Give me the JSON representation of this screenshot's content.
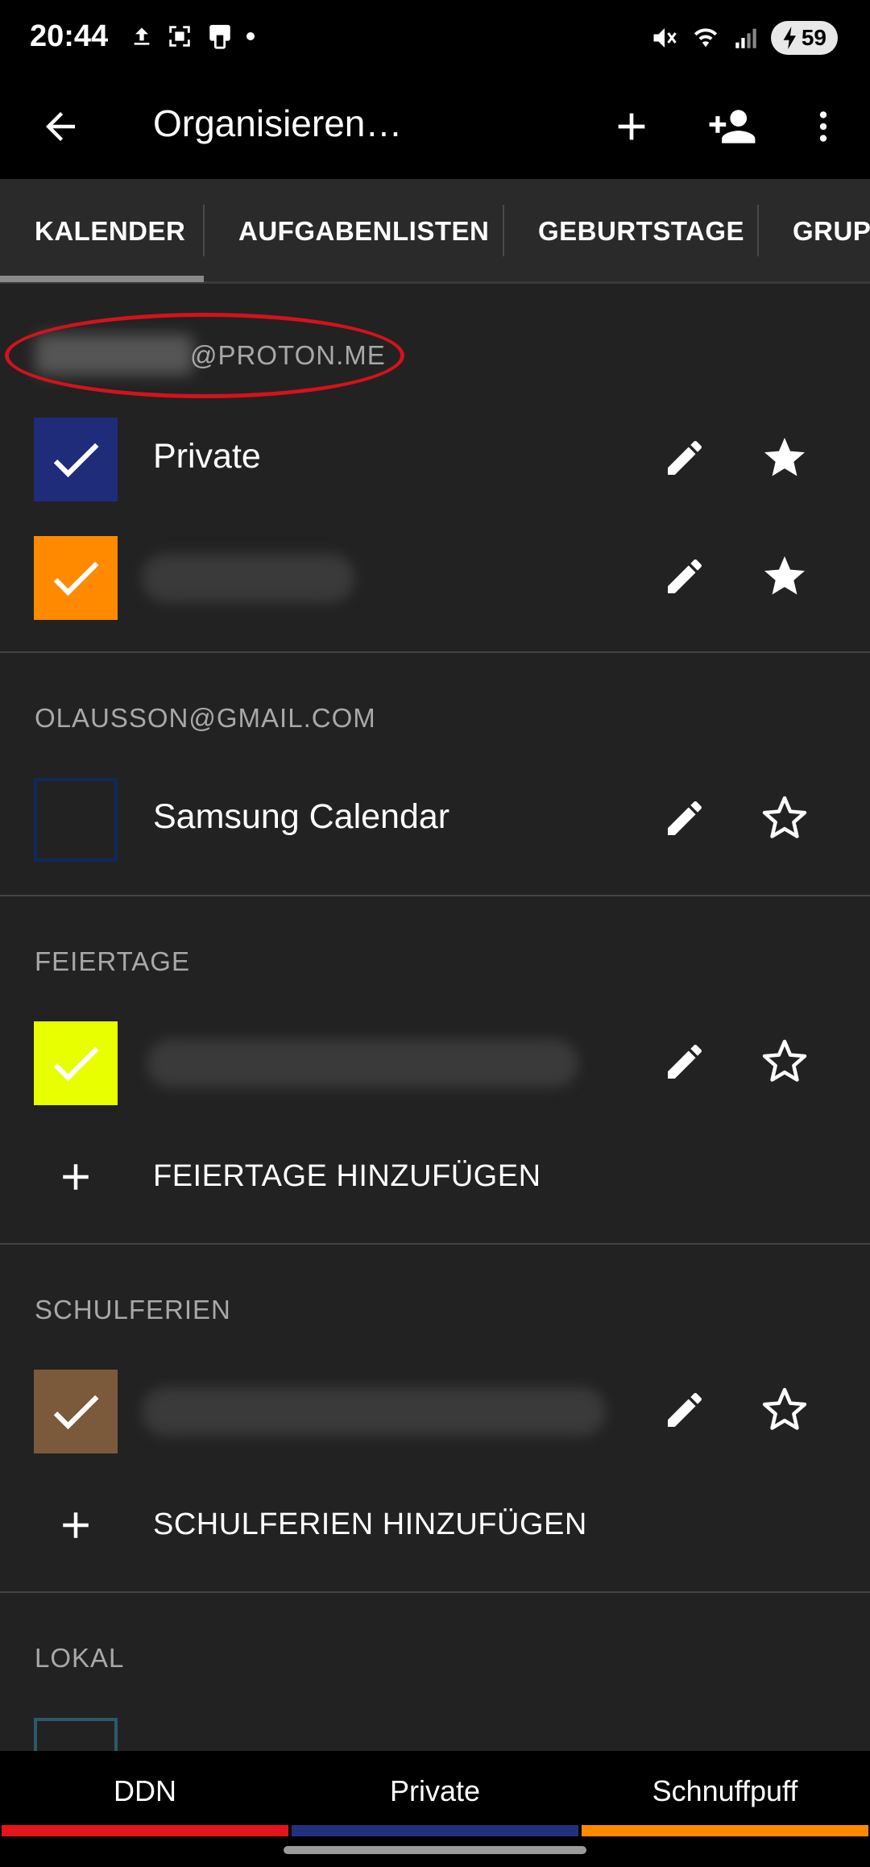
{
  "status_bar": {
    "time": "20:44",
    "battery": "59"
  },
  "app_bar": {
    "title": "Organisieren…"
  },
  "tabs": [
    {
      "label": "KALENDER"
    },
    {
      "label": "AUFGABENLISTEN"
    },
    {
      "label": "GEBURTSTAGE"
    },
    {
      "label": "GRUPPEN"
    }
  ],
  "sections": {
    "proton": {
      "header": "@PROTON.ME"
    },
    "gmail": {
      "header": "OLAUSSON@GMAIL.COM"
    },
    "feiertage": {
      "header": "FEIERTAGE",
      "add_label": "FEIERTAGE HINZUFÜGEN"
    },
    "schulferien": {
      "header": "SCHULFERIEN",
      "add_label": "SCHULFERIEN HINZUFÜGEN"
    },
    "lokal": {
      "header": "LOKAL"
    }
  },
  "calendars": {
    "private": {
      "name": "Private",
      "color": "#1f2c7a",
      "checked": true,
      "favorite": true
    },
    "schnuffpuff": {
      "name": "",
      "color": "#ff8a00",
      "checked": true,
      "favorite": true
    },
    "samsung": {
      "name": "Samsung Calendar",
      "color": "#0f2a5a",
      "checked": false,
      "favorite": false
    },
    "holidays": {
      "name": "",
      "color": "#e8ff00",
      "checked": true,
      "favorite": false
    },
    "schoolholidays": {
      "name": "",
      "color": "#7a5a3a",
      "checked": true,
      "favorite": false
    },
    "local": {
      "name": "",
      "color": "#2a5a6a",
      "checked": false,
      "favorite": false
    }
  },
  "bottom_bar": [
    {
      "label": "DDN",
      "color": "#e4141c"
    },
    {
      "label": "Private",
      "color": "#23307e"
    },
    {
      "label": "Schnuffpuff",
      "color": "#ff8a00"
    }
  ]
}
